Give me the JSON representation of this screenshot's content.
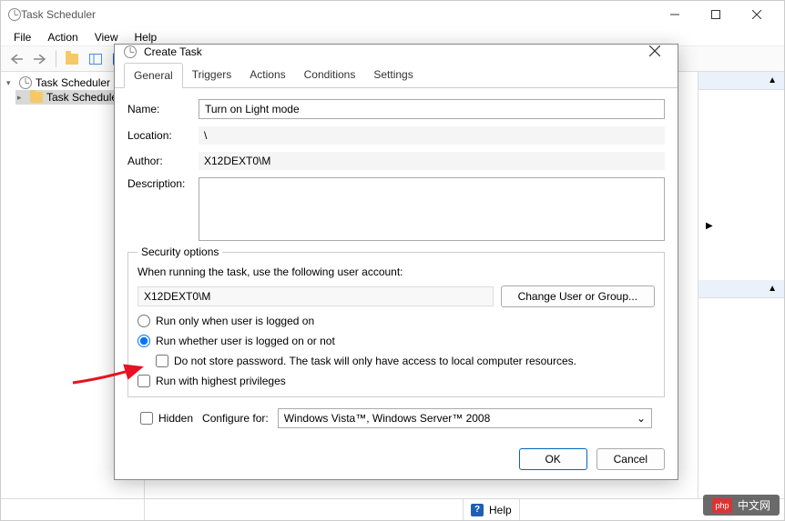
{
  "mainWindow": {
    "title": "Task Scheduler",
    "menus": [
      "File",
      "Action",
      "View",
      "Help"
    ],
    "tree": {
      "root": "Task Scheduler (L",
      "child": "Task Schedule"
    }
  },
  "statusBar": {
    "help": "Help"
  },
  "dialog": {
    "title": "Create Task",
    "tabs": [
      "General",
      "Triggers",
      "Actions",
      "Conditions",
      "Settings"
    ],
    "labels": {
      "name": "Name:",
      "location": "Location:",
      "author": "Author:",
      "description": "Description:",
      "security": "Security options",
      "userPrompt": "When running the task, use the following user account:",
      "changeUser": "Change User or Group...",
      "radio1": "Run only when user is logged on",
      "radio2": "Run whether user is logged on or not",
      "noPass": "Do not store password.  The task will only have access to local computer resources.",
      "highest": "Run with highest privileges",
      "hidden": "Hidden",
      "configFor": "Configure for:",
      "ok": "OK",
      "cancel": "Cancel"
    },
    "values": {
      "name": "Turn on Light mode",
      "location": "\\",
      "author": "X12DEXT0\\M",
      "description": "",
      "userAccount": "X12DEXT0\\M",
      "configSelected": "Windows Vista™, Windows Server™ 2008"
    }
  },
  "watermark": "中文网"
}
